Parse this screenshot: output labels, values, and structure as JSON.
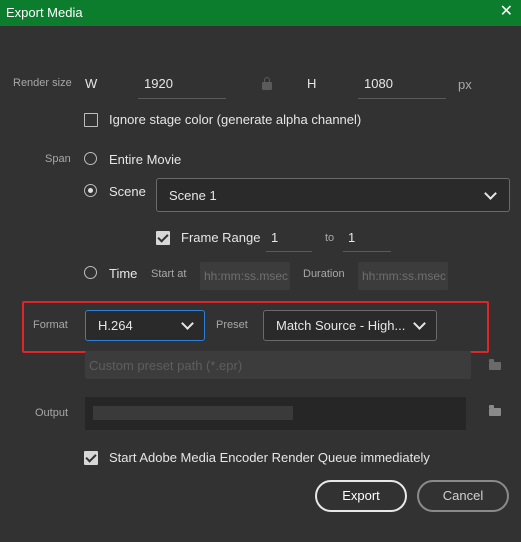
{
  "window": {
    "title": "Export Media",
    "close_symbol": "✕"
  },
  "render_size": {
    "label": "Render size",
    "w_label": "W",
    "width": "1920",
    "h_label": "H",
    "height": "1080",
    "unit": "px"
  },
  "ignore_stage": {
    "label": "Ignore stage color (generate alpha channel)",
    "checked": false
  },
  "span": {
    "label": "Span",
    "entire_movie": {
      "label": "Entire Movie",
      "selected": false
    },
    "scene": {
      "label": "Scene",
      "selected": true,
      "value": "Scene 1"
    },
    "frame_range": {
      "label": "Frame Range",
      "checked": true,
      "from": "1",
      "to_label": "to",
      "to": "1"
    },
    "time": {
      "label": "Time",
      "selected": false,
      "start_label": "Start at",
      "start_placeholder": "hh:mm:ss.msec",
      "duration_label": "Duration",
      "duration_placeholder": "hh:mm:ss.msec"
    }
  },
  "format": {
    "label": "Format",
    "value": "H.264",
    "preset_label": "Preset",
    "preset_value": "Match Source - High..."
  },
  "custom_preset": {
    "placeholder": "Custom preset path (*.epr)"
  },
  "output": {
    "label": "Output"
  },
  "start_queue": {
    "label": "Start Adobe Media Encoder Render Queue immediately",
    "checked": true
  },
  "buttons": {
    "export": "Export",
    "cancel": "Cancel"
  },
  "colors": {
    "title_bar": "#0b7d2d",
    "background": "#323232",
    "highlight": "#e0242a"
  }
}
